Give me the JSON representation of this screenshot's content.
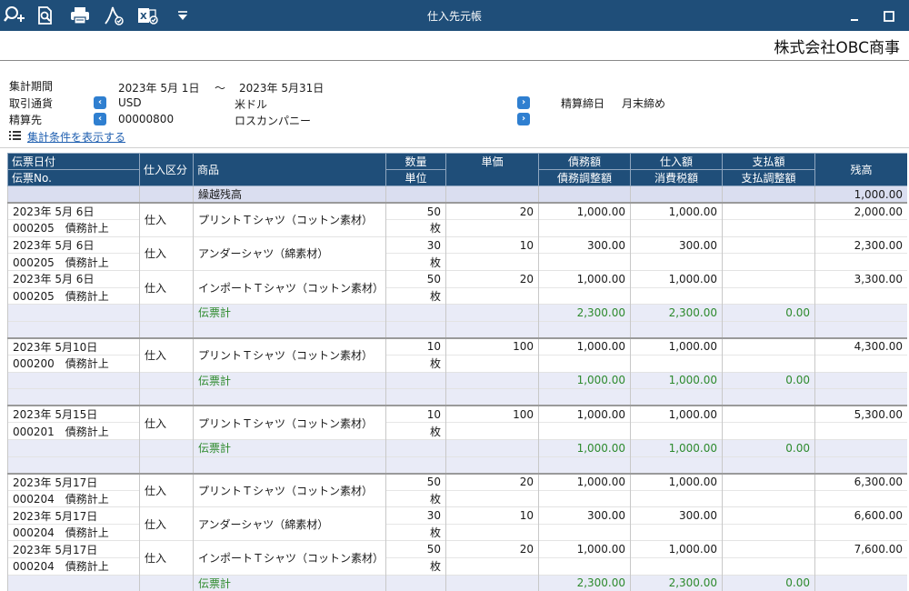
{
  "window": {
    "title": "仕入先元帳",
    "company": "株式会社OBC商事"
  },
  "toolbar": {
    "icons": [
      "zoom-in-icon",
      "find-icon",
      "print-icon",
      "pdf-icon",
      "excel-icon",
      "dropdown-icon"
    ]
  },
  "conditions": {
    "period_label": "集計期間",
    "period_from": "2023年  5月  1日",
    "period_tilde": "〜",
    "period_to": "2023年  5月31日",
    "currency_label": "取引通貨",
    "currency_code": "USD",
    "currency_name": "米ドル",
    "settle_label": "精算先",
    "settle_code": "00000800",
    "settle_name": "ロスカンパニー",
    "closing_label": "精算締日",
    "closing_value": "月末締め",
    "show_conditions": "集計条件を表示する"
  },
  "colors": {
    "titlebar": "#1f4e79",
    "header": "#1f4e79",
    "subtotal_text": "#2d8a2d",
    "link": "#1f5fb0"
  },
  "table": {
    "headers": {
      "date": "伝票日付",
      "slip_no": "伝票No.",
      "kubun": "仕入区分",
      "item": "商品",
      "qty": "数量",
      "unit": "単位",
      "price": "単価",
      "debt": "債務額",
      "debt_adj": "債務調整額",
      "purchase": "仕入額",
      "tax": "消費税額",
      "payment": "支払額",
      "payment_adj": "支払調整額",
      "balance": "残高"
    },
    "carry": {
      "label": "繰越残高",
      "balance": "1,000.00"
    },
    "groups": [
      {
        "lines": [
          {
            "date": "2023年  5月  6日",
            "slip": "000205　債務計上",
            "kubun": "仕入",
            "item": "プリントＴシャツ（コットン素材）",
            "qty": "50",
            "unit": "枚",
            "price": "20",
            "debt": "1,000.00",
            "purchase": "1,000.00",
            "balance": "2,000.00"
          },
          {
            "date": "2023年  5月  6日",
            "slip": "000205　債務計上",
            "kubun": "仕入",
            "item": "アンダーシャツ（綿素材）",
            "qty": "30",
            "unit": "枚",
            "price": "10",
            "debt": "300.00",
            "purchase": "300.00",
            "balance": "2,300.00"
          },
          {
            "date": "2023年  5月  6日",
            "slip": "000205　債務計上",
            "kubun": "仕入",
            "item": "インポートＴシャツ（コットン素材）",
            "qty": "50",
            "unit": "枚",
            "price": "20",
            "debt": "1,000.00",
            "purchase": "1,000.00",
            "balance": "3,300.00"
          }
        ],
        "subtotal": {
          "label": "伝票計",
          "debt": "2,300.00",
          "purchase": "2,300.00",
          "payment": "0.00"
        }
      },
      {
        "lines": [
          {
            "date": "2023年  5月10日",
            "slip": "000200　債務計上",
            "kubun": "仕入",
            "item": "プリントＴシャツ（コットン素材）",
            "qty": "10",
            "unit": "枚",
            "price": "100",
            "debt": "1,000.00",
            "purchase": "1,000.00",
            "balance": "4,300.00"
          }
        ],
        "subtotal": {
          "label": "伝票計",
          "debt": "1,000.00",
          "purchase": "1,000.00",
          "payment": "0.00"
        }
      },
      {
        "lines": [
          {
            "date": "2023年  5月15日",
            "slip": "000201　債務計上",
            "kubun": "仕入",
            "item": "プリントＴシャツ（コットン素材）",
            "qty": "10",
            "unit": "枚",
            "price": "100",
            "debt": "1,000.00",
            "purchase": "1,000.00",
            "balance": "5,300.00"
          }
        ],
        "subtotal": {
          "label": "伝票計",
          "debt": "1,000.00",
          "purchase": "1,000.00",
          "payment": "0.00"
        }
      },
      {
        "lines": [
          {
            "date": "2023年  5月17日",
            "slip": "000204　債務計上",
            "kubun": "仕入",
            "item": "プリントＴシャツ（コットン素材）",
            "qty": "50",
            "unit": "枚",
            "price": "20",
            "debt": "1,000.00",
            "purchase": "1,000.00",
            "balance": "6,300.00"
          },
          {
            "date": "2023年  5月17日",
            "slip": "000204　債務計上",
            "kubun": "仕入",
            "item": "アンダーシャツ（綿素材）",
            "qty": "30",
            "unit": "枚",
            "price": "10",
            "debt": "300.00",
            "purchase": "300.00",
            "balance": "6,600.00"
          },
          {
            "date": "2023年  5月17日",
            "slip": "000204　債務計上",
            "kubun": "仕入",
            "item": "インポートＴシャツ（コットン素材）",
            "qty": "50",
            "unit": "枚",
            "price": "20",
            "debt": "1,000.00",
            "purchase": "1,000.00",
            "balance": "7,600.00"
          }
        ],
        "subtotal": {
          "label": "伝票計",
          "debt": "2,300.00",
          "purchase": "2,300.00",
          "payment": "0.00"
        }
      }
    ]
  }
}
